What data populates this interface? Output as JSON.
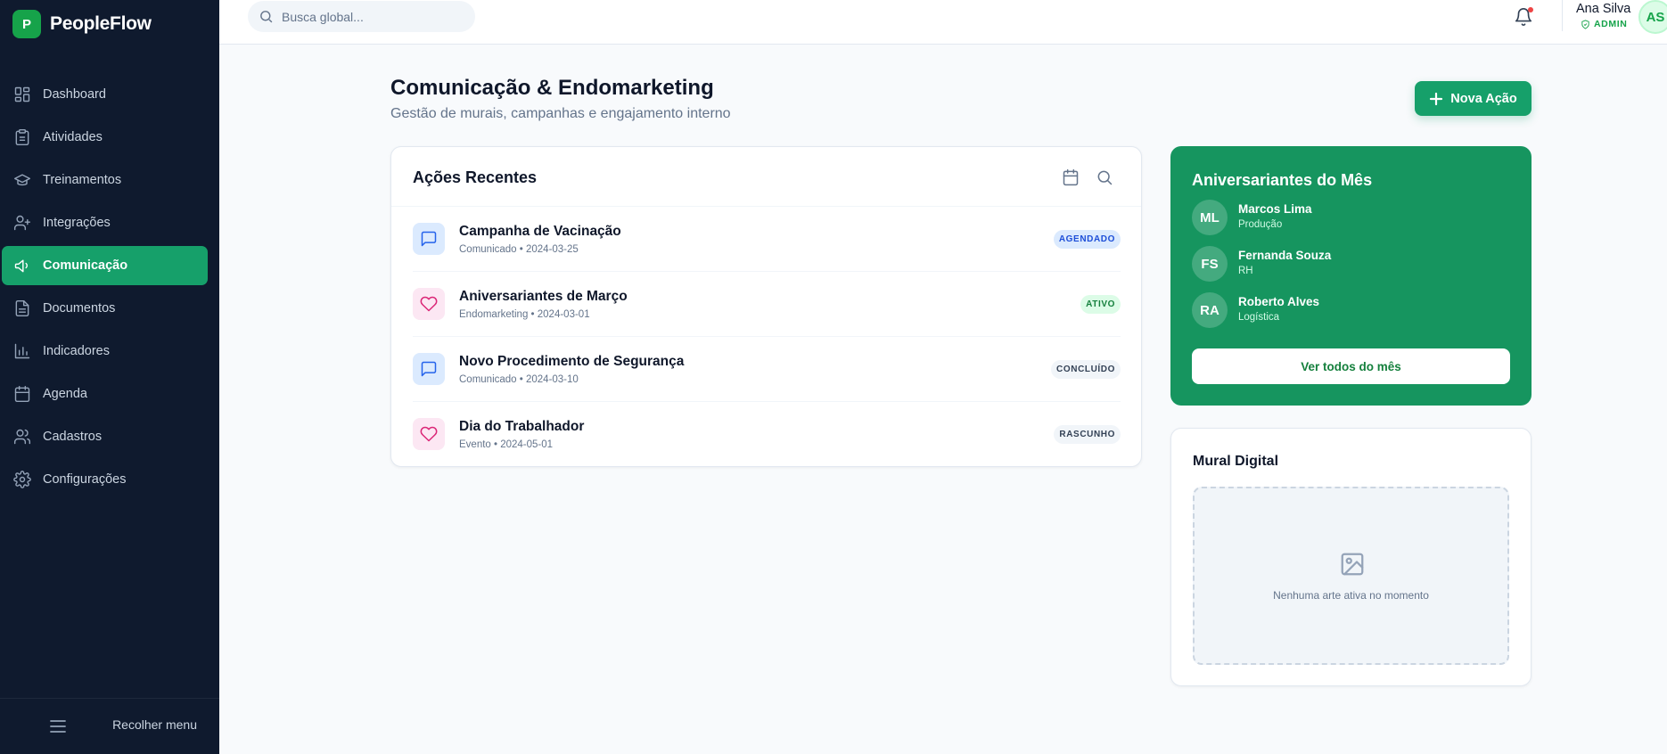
{
  "app": {
    "logo_letter": "P",
    "name": "PeopleFlow"
  },
  "sidebar": {
    "items": [
      {
        "label": "Dashboard",
        "icon": "dashboard-icon"
      },
      {
        "label": "Atividades",
        "icon": "clipboard-icon"
      },
      {
        "label": "Treinamentos",
        "icon": "graduation-cap-icon"
      },
      {
        "label": "Integrações",
        "icon": "user-plus-icon"
      },
      {
        "label": "Comunicação",
        "icon": "megaphone-icon",
        "active": true
      },
      {
        "label": "Documentos",
        "icon": "document-icon"
      },
      {
        "label": "Indicadores",
        "icon": "bar-chart-icon"
      },
      {
        "label": "Agenda",
        "icon": "calendar-icon"
      },
      {
        "label": "Cadastros",
        "icon": "users-icon"
      },
      {
        "label": "Configurações",
        "icon": "gear-icon"
      }
    ],
    "collapse_label": "Recolher menu"
  },
  "topbar": {
    "search_placeholder": "Busca global...",
    "user_name": "Ana Silva",
    "user_role": "ADMIN",
    "user_initials": "AS"
  },
  "page": {
    "title": "Comunicação & Endomarketing",
    "subtitle": "Gestão de murais, campanhas e engajamento interno",
    "new_action_label": "Nova Ação"
  },
  "recent": {
    "title": "Ações Recentes",
    "items": [
      {
        "title": "Campanha de Vacinação",
        "meta": "Comunicado • 2024-03-25",
        "status": "AGENDADO",
        "icon": "message-icon"
      },
      {
        "title": "Aniversariantes de Março",
        "meta": "Endomarketing • 2024-03-01",
        "status": "ATIVO",
        "icon": "heart-icon"
      },
      {
        "title": "Novo Procedimento de Segurança",
        "meta": "Comunicado • 2024-03-10",
        "status": "CONCLUÍDO",
        "icon": "message-icon"
      },
      {
        "title": "Dia do Trabalhador",
        "meta": "Evento • 2024-05-01",
        "status": "RASCUNHO",
        "icon": "heart-icon"
      }
    ]
  },
  "birthdays": {
    "title": "Aniversariantes do Mês",
    "people": [
      {
        "initials": "ML",
        "name": "Marcos Lima",
        "dept": "Produção"
      },
      {
        "initials": "FS",
        "name": "Fernanda Souza",
        "dept": "RH"
      },
      {
        "initials": "RA",
        "name": "Roberto Alves",
        "dept": "Logística"
      }
    ],
    "button_label": "Ver todos do mês"
  },
  "mural": {
    "title": "Mural Digital",
    "empty_text": "Nenhuma arte ativa no momento"
  },
  "colors": {
    "sidebar_bg": "#0f1a2e",
    "accent": "#16a06a",
    "birthday_card": "#16955f"
  }
}
